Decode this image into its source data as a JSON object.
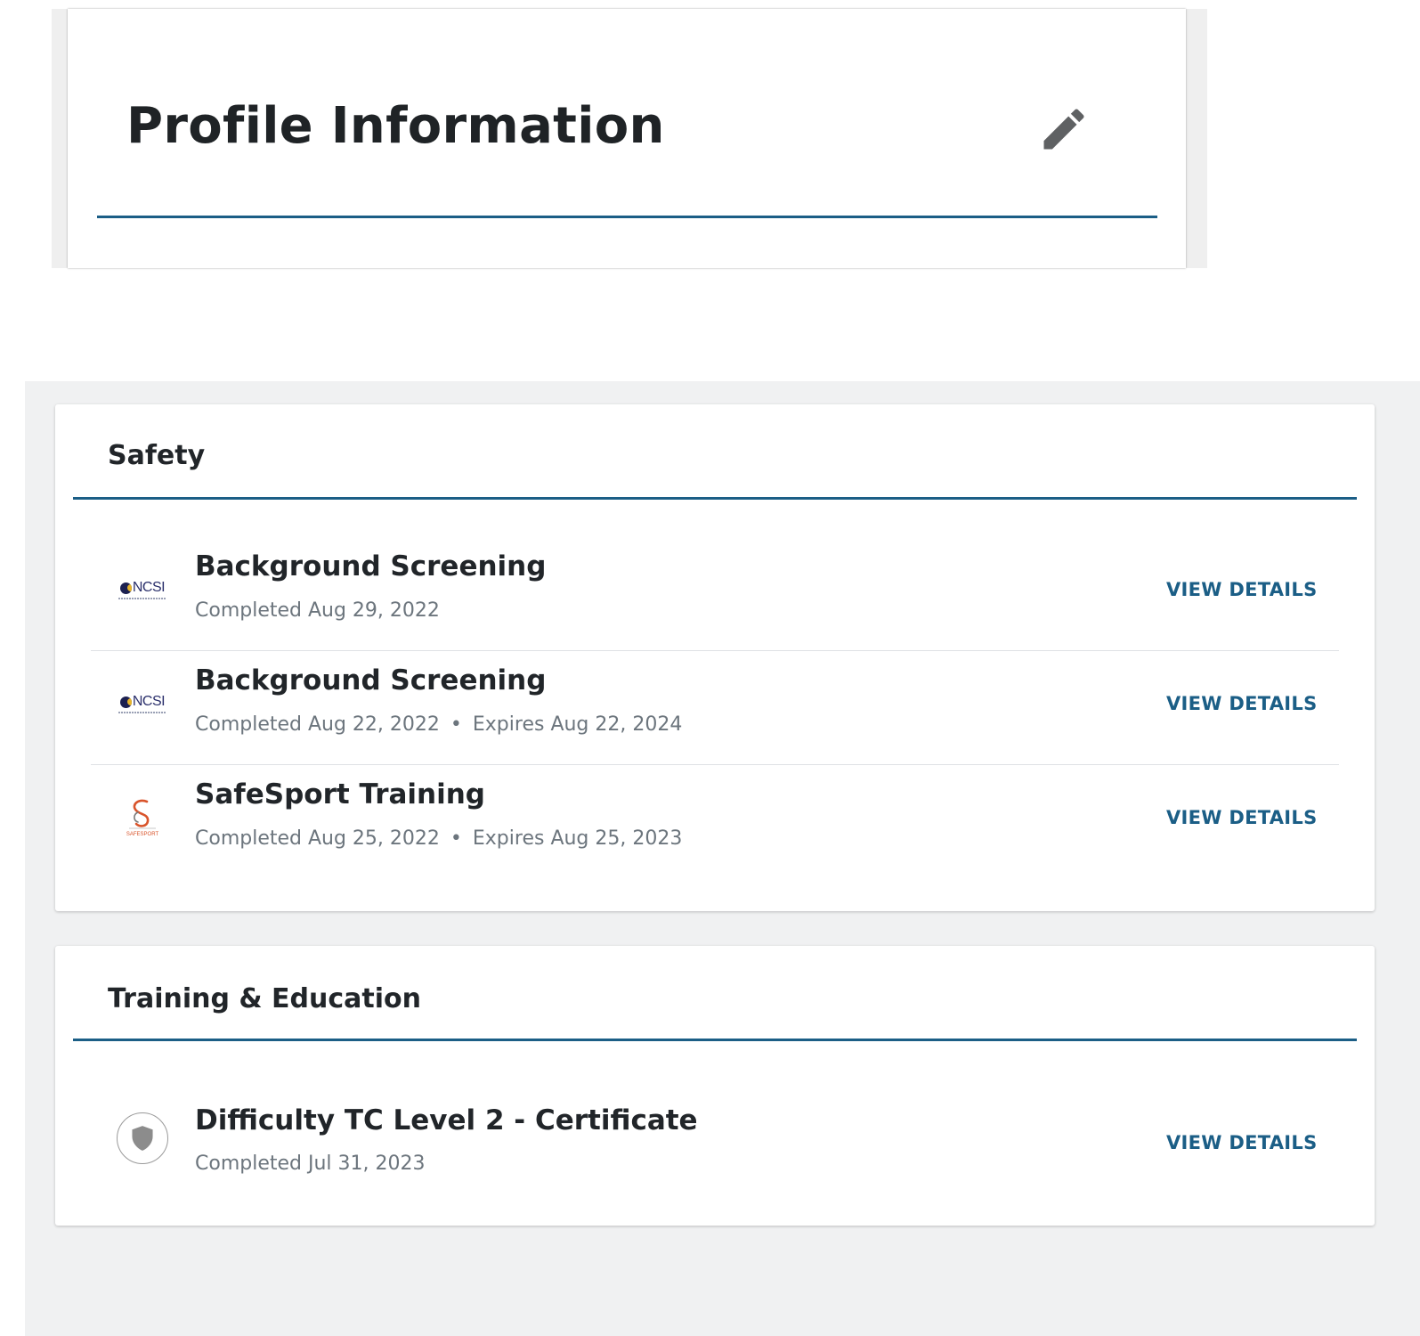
{
  "profile": {
    "title": "Profile Information",
    "edit_icon": "pencil-icon"
  },
  "colors": {
    "accent": "#1b5e86",
    "muted_text": "#6c757d",
    "panel_bg": "#f0f1f2"
  },
  "safety": {
    "title": "Safety",
    "items": [
      {
        "logo": "ncsi-logo",
        "logo_text": "NCSI",
        "title": "Background Screening",
        "completed": "Completed Aug 29, 2022",
        "expires": "",
        "action": "VIEW DETAILS"
      },
      {
        "logo": "ncsi-logo",
        "logo_text": "NCSI",
        "title": "Background Screening",
        "completed": "Completed Aug 22, 2022",
        "expires": "Expires Aug 22, 2024",
        "action": "VIEW DETAILS"
      },
      {
        "logo": "safesport-logo",
        "logo_text": "SAFESPORT",
        "title": "SafeSport Training",
        "completed": "Completed Aug 25, 2022",
        "expires": "Expires Aug 25, 2023",
        "action": "VIEW DETAILS"
      }
    ]
  },
  "training": {
    "title": "Training & Education",
    "items": [
      {
        "logo": "shield-badge-icon",
        "title": "Difficulty TC Level 2 - Certificate",
        "completed": "Completed Jul 31, 2023",
        "action": "VIEW DETAILS"
      }
    ]
  }
}
